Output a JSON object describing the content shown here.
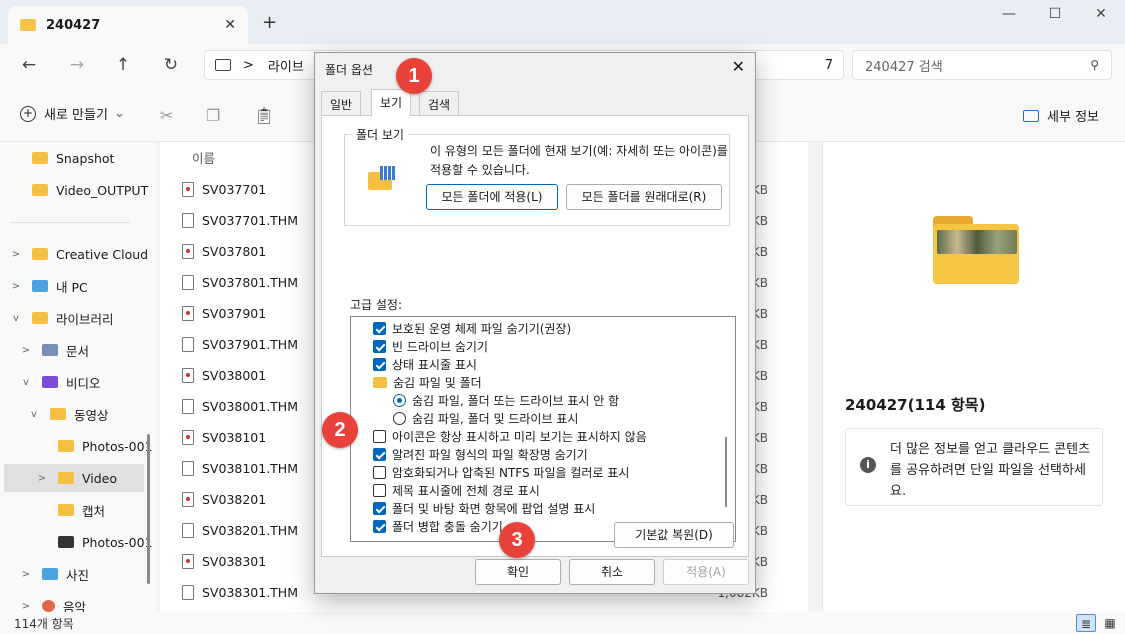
{
  "window": {
    "tab_title": "240427",
    "tab_close": "✕",
    "new_tab": "+",
    "minimize": "—",
    "maximize": "☐",
    "close": "✕"
  },
  "nav": {
    "back": "←",
    "forward": "→",
    "up": "↑",
    "refresh": "↻",
    "breadcrumb_sep": ">",
    "breadcrumb": "라이브",
    "breadcrumb_tail": "7",
    "search_placeholder": "240427 검색",
    "search_icon": "⚲"
  },
  "toolbar": {
    "new_label": "새로 만들기",
    "new_chevron": "⌄",
    "details_label": "세부 정보"
  },
  "sidebar": {
    "items": [
      {
        "label": "Snapshot",
        "icon": "folder-icon"
      },
      {
        "label": "Video_OUTPUT",
        "icon": "folder-icon"
      },
      {
        "label": "Creative Cloud",
        "icon": "creative-cloud-icon"
      },
      {
        "label": "내 PC",
        "icon": "pc-icon"
      },
      {
        "label": "라이브러리",
        "icon": "library-icon"
      },
      {
        "label": "문서",
        "icon": "documents-icon"
      },
      {
        "label": "비디오",
        "icon": "video-icon"
      },
      {
        "label": "동영상",
        "icon": "folder-icon"
      },
      {
        "label": "Photos-001",
        "icon": "folder-icon"
      },
      {
        "label": "Video",
        "icon": "folder-icon"
      },
      {
        "label": "캡처",
        "icon": "folder-icon"
      },
      {
        "label": "Photos-001",
        "icon": "zip-icon"
      },
      {
        "label": "사진",
        "icon": "pictures-icon"
      },
      {
        "label": "음악",
        "icon": "music-icon"
      }
    ]
  },
  "filelist": {
    "column_name": "이름",
    "files": [
      {
        "name": "SV037701",
        "size": "KB",
        "type": "video"
      },
      {
        "name": "SV037701.THM",
        "size": "KB",
        "type": "file"
      },
      {
        "name": "SV037801",
        "size": "KB",
        "type": "video"
      },
      {
        "name": "SV037801.THM",
        "size": "KB",
        "type": "file"
      },
      {
        "name": "SV037901",
        "size": "KB",
        "type": "video"
      },
      {
        "name": "SV037901.THM",
        "size": "KB",
        "type": "file"
      },
      {
        "name": "SV038001",
        "size": "KB",
        "type": "video"
      },
      {
        "name": "SV038001.THM",
        "size": "KB",
        "type": "file"
      },
      {
        "name": "SV038101",
        "size": "KB",
        "type": "video"
      },
      {
        "name": "SV038101.THM",
        "size": "KB",
        "type": "file"
      },
      {
        "name": "SV038201",
        "size": "KB",
        "type": "video"
      },
      {
        "name": "SV038201.THM",
        "size": "KB",
        "type": "file"
      },
      {
        "name": "SV038301",
        "size": "KB",
        "type": "video"
      },
      {
        "name": "SV038301.THM",
        "size": "1,082KB",
        "type": "file"
      }
    ]
  },
  "details": {
    "title": "240427(114 항목)",
    "info_text": "더 많은 정보를 얻고 클라우드 콘텐츠를 공유하려면 단일 파일을 선택하세요.",
    "info_icon": "i"
  },
  "status": {
    "count": "114개 항목",
    "details_view_icon": "≣",
    "tiles_view_icon": "▦"
  },
  "dialog": {
    "title": "폴더 옵션",
    "close": "✕",
    "tabs": [
      "일반",
      "보기",
      "검색"
    ],
    "group_label": "폴더 보기",
    "group_desc": "이 유형의 모든 폴더에 현재 보기(예: 자세히 또는 아이콘)를 적용할 수 있습니다.",
    "apply_all": "모든 폴더에 적용(L)",
    "reset_all": "모든 폴더를 원래대로(R)",
    "advanced_label": "고급 설정:",
    "settings": [
      {
        "label": "보호된 운영 체제 파일 숨기기(권장)",
        "kind": "check",
        "checked": true
      },
      {
        "label": "빈 드라이브 숨기기",
        "kind": "check",
        "checked": true
      },
      {
        "label": "상태 표시줄 표시",
        "kind": "check",
        "checked": true
      },
      {
        "label": "숨김 파일 및 폴더",
        "kind": "folder",
        "checked": false
      },
      {
        "label": "숨김 파일, 폴더 또는 드라이브 표시 안 함",
        "kind": "radio",
        "checked": true
      },
      {
        "label": "숨김 파일, 폴더 및 드라이브 표시",
        "kind": "radio",
        "checked": false
      },
      {
        "label": "아이콘은 항상 표시하고 미리 보기는 표시하지 않음",
        "kind": "check",
        "checked": false
      },
      {
        "label": "알려진 파일 형식의 파일 확장명 숨기기",
        "kind": "check",
        "checked": true
      },
      {
        "label": "암호화되거나 압축된 NTFS 파일을 컬러로 표시",
        "kind": "check",
        "checked": false
      },
      {
        "label": "제목 표시줄에 전체 경로 표시",
        "kind": "check",
        "checked": false
      },
      {
        "label": "폴더 및 바탕 화면 항목에 팝업 설명 표시",
        "kind": "check",
        "checked": true
      },
      {
        "label": "폴더 병합 충돌 숨기기",
        "kind": "check",
        "checked": true
      }
    ],
    "restore_defaults": "기본값 복원(D)",
    "ok": "확인",
    "cancel": "취소",
    "apply": "적용(A)"
  },
  "annotations": [
    "1",
    "2",
    "3"
  ],
  "colors": {
    "accent": "#0067c0",
    "badge": "#e8423a",
    "folder": "#f5c042"
  }
}
